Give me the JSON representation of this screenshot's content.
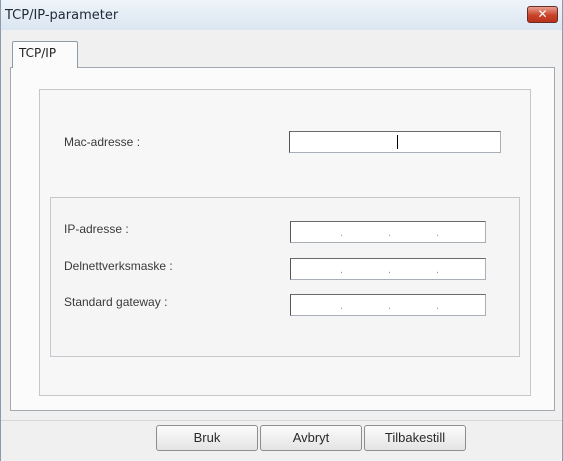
{
  "window": {
    "title": "TCP/IP-parameter",
    "close_symbol": "✕"
  },
  "tabs": [
    {
      "label": "TCP/IP",
      "selected": true
    }
  ],
  "fields": {
    "mac": {
      "label": "Mac-adresse :",
      "value": ""
    },
    "ip": {
      "label": "IP-adresse :",
      "value": "",
      "separator": "."
    },
    "subnet": {
      "label": "Delnettverksmaske :",
      "value": "",
      "separator": "."
    },
    "gateway": {
      "label": "Standard gateway :",
      "value": "",
      "separator": "."
    }
  },
  "buttons": {
    "apply": "Bruk",
    "cancel": "Avbryt",
    "reset": "Tilbakestill"
  },
  "colors": {
    "close_button": "#c9432b",
    "title_bar": "#dbe6f1"
  }
}
